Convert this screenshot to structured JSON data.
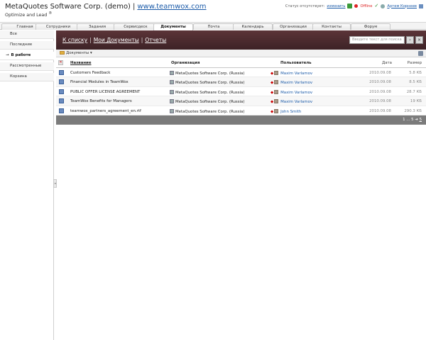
{
  "header": {
    "company": "MetaQuotes Software Corp. (demo)",
    "separator": "|",
    "site": "www.teamwox.com",
    "tagline": "Optimize and Lead",
    "tagline_mark": "®"
  },
  "status": {
    "absent_text": "Статус отсутствует:",
    "change_label": "изменить",
    "offline_label": "Offline",
    "user_name": "Артем Корнеев",
    "status_icon": "status-icon",
    "offline_icon": "offline-dot-icon",
    "check_icon": "check-icon",
    "user_icon": "user-icon",
    "logout_icon": "logout-icon"
  },
  "tabs": [
    {
      "label": "Главная",
      "active": false
    },
    {
      "label": "Сотрудники",
      "active": false
    },
    {
      "label": "Задания",
      "active": false
    },
    {
      "label": "Сервисдеск",
      "active": false
    },
    {
      "label": "Документы",
      "active": true
    },
    {
      "label": "Почта",
      "active": false
    },
    {
      "label": "Календарь",
      "active": false
    },
    {
      "label": "Организации",
      "active": false
    },
    {
      "label": "Контакты",
      "active": false
    },
    {
      "label": "Форум",
      "active": false
    }
  ],
  "sidebar": {
    "items": [
      {
        "label": "Все",
        "active": false
      },
      {
        "label": "Последние",
        "active": false
      },
      {
        "label": "В работе",
        "active": true
      },
      {
        "label": "Рассмотренные",
        "active": false
      },
      {
        "label": "Корзина",
        "active": false
      }
    ],
    "active_marker": "→",
    "collapse_glyph": "◂"
  },
  "breadcrumbs": {
    "back": "К списку",
    "my_docs": "Мои Документы",
    "reports": "Отчеты",
    "pipe": "|"
  },
  "search": {
    "placeholder": "Введите текст для поиска",
    "go_glyph": "›",
    "clear_glyph": "×"
  },
  "toolbar": {
    "documents_label": "Документы",
    "dropdown_glyph": "▾"
  },
  "table": {
    "columns": {
      "name": "Название",
      "org": "Организация",
      "user": "Пользователь",
      "date": "Дата",
      "size": "Размер"
    },
    "select_glyph": "✕",
    "user_marker": "◆",
    "rows": [
      {
        "name": "Customers Feedback",
        "org": "MetaQuotes Software Corp. (Russia)",
        "user": "Maxim Varlamov",
        "date": "2010.09.08",
        "size": "5.8 КБ"
      },
      {
        "name": "Financial Modules in TeamWox",
        "org": "MetaQuotes Software Corp. (Russia)",
        "user": "Maxim Varlamov",
        "date": "2010.09.08",
        "size": "8.5 КБ"
      },
      {
        "name": "PUBLIC OFFER LICENSE AGREEMENT",
        "org": "MetaQuotes Software Corp. (Russia)",
        "user": "Maxim Varlamov",
        "date": "2010.09.08",
        "size": "28.7 КБ"
      },
      {
        "name": "TeamWox Benefits for Managers",
        "org": "MetaQuotes Software Corp. (Russia)",
        "user": "Maxim Varlamov",
        "date": "2010.09.08",
        "size": "19 КБ"
      },
      {
        "name": "teamwox_partners_agreement_en.rtf",
        "org": "MetaQuotes Software Corp. (Russia)",
        "user": "John Smith",
        "date": "2010.09.08",
        "size": "290.3 КБ"
      }
    ]
  },
  "pager": {
    "range": "1 ... 5",
    "arrow": "➔",
    "last": "5"
  }
}
